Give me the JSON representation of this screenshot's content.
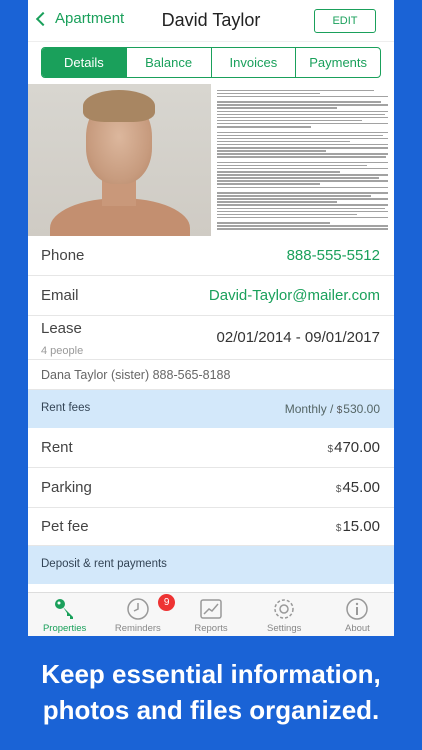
{
  "nav": {
    "back_label": "Apartment",
    "title": "David Taylor",
    "edit_label": "EDIT"
  },
  "tabs": [
    {
      "label": "Details",
      "active": true
    },
    {
      "label": "Balance",
      "active": false
    },
    {
      "label": "Invoices",
      "active": false
    },
    {
      "label": "Payments",
      "active": false
    }
  ],
  "details": {
    "phone_label": "Phone",
    "phone_value": "888-555-5512",
    "email_label": "Email",
    "email_value": "David-Taylor@mailer.com",
    "lease_label": "Lease",
    "lease_sub": "4 people",
    "lease_value": "02/01/2014 - 09/01/2017",
    "contact": "Dana Taylor (sister) 888-565-8188"
  },
  "rent": {
    "section_label": "Rent fees",
    "period": "Monthly / ",
    "currency": "$",
    "total": "530.00",
    "items": [
      {
        "label": "Rent",
        "amount": "470.00"
      },
      {
        "label": "Parking",
        "amount": "45.00"
      },
      {
        "label": "Pet fee",
        "amount": "15.00"
      }
    ]
  },
  "deposit": {
    "section_label": "Deposit & rent payments"
  },
  "tabbar": {
    "properties": "Properties",
    "reminders": "Reminders",
    "reminders_badge": "9",
    "reports": "Reports",
    "settings": "Settings",
    "about": "About"
  },
  "caption": {
    "line1": "Keep essential information,",
    "line2": "photos and files organized."
  },
  "colors": {
    "accent": "#1aa05b",
    "background": "#1a63d6",
    "section": "#d3e8fa",
    "badge": "#e33333"
  }
}
